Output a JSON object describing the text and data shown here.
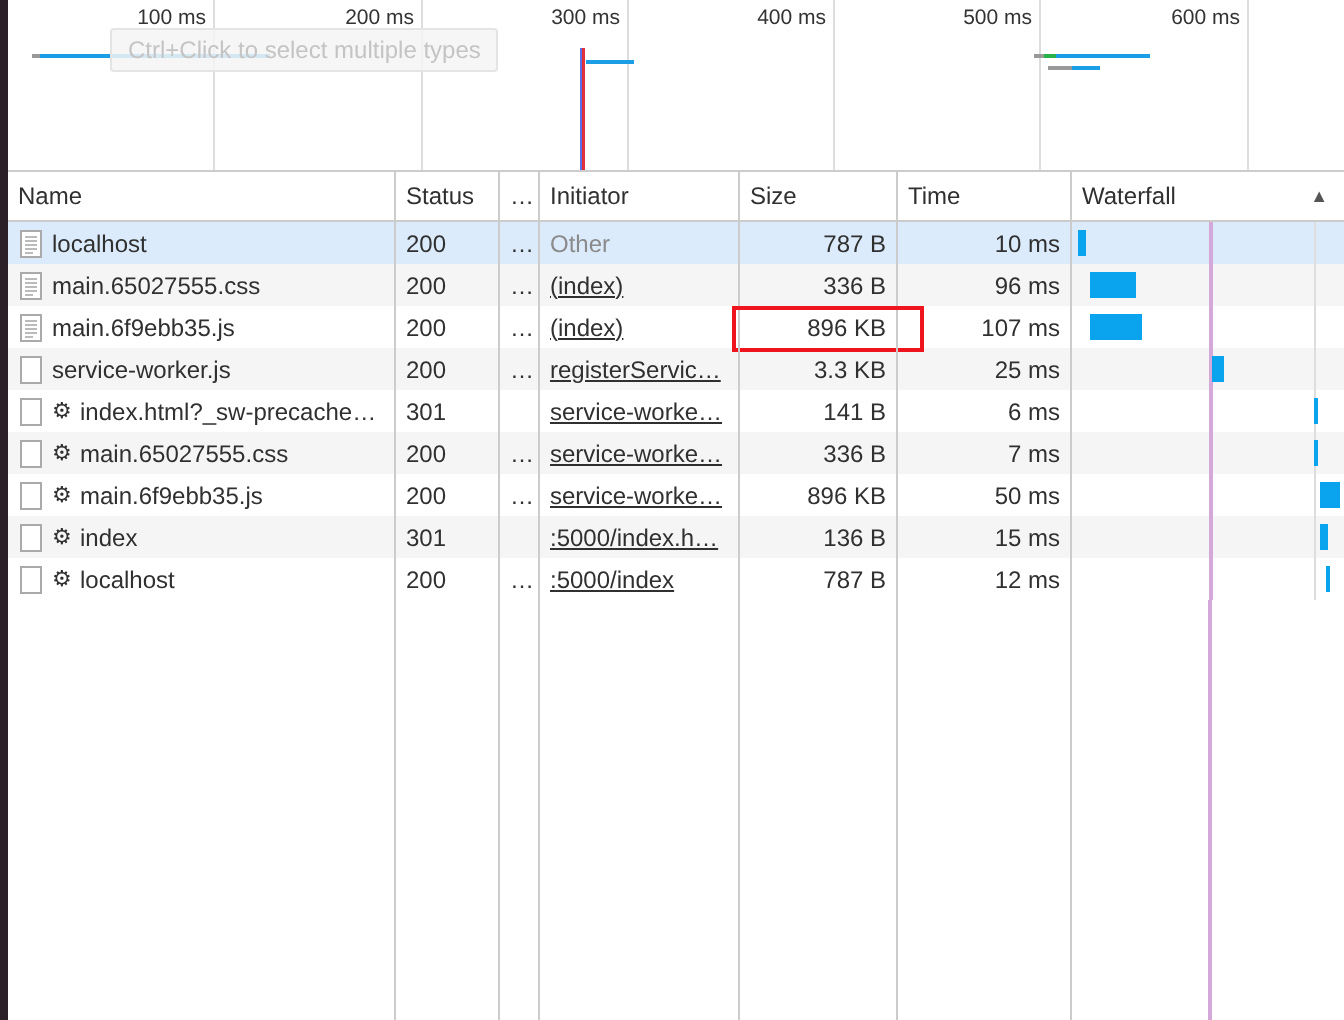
{
  "overview": {
    "ticks": [
      "100 ms",
      "200 ms",
      "300 ms",
      "400 ms",
      "500 ms",
      "600 ms"
    ],
    "tooltip": "Ctrl+Click to select multiple types"
  },
  "table": {
    "columns": [
      {
        "label": "Name"
      },
      {
        "label": "Status"
      },
      {
        "label": "…"
      },
      {
        "label": "Initiator"
      },
      {
        "label": "Size"
      },
      {
        "label": "Time"
      },
      {
        "label": "Waterfall",
        "sort": "▲"
      }
    ],
    "rows": [
      {
        "kind": "document",
        "gear": "",
        "name": "localhost",
        "status": "200",
        "more": "…",
        "initiator": "Other",
        "initiator_link": false,
        "size": "787 B",
        "time": "10 ms",
        "selected": true,
        "highlighted": false
      },
      {
        "kind": "document",
        "gear": "",
        "name": "main.65027555.css",
        "status": "200",
        "more": "…",
        "initiator": "(index)",
        "initiator_link": true,
        "size": "336 B",
        "time": "96 ms",
        "selected": false,
        "highlighted": false
      },
      {
        "kind": "document",
        "gear": "",
        "name": "main.6f9ebb35.js",
        "status": "200",
        "more": "…",
        "initiator": "(index)",
        "initiator_link": true,
        "size": "896 KB",
        "time": "107 ms",
        "selected": false,
        "highlighted": true
      },
      {
        "kind": "blank",
        "gear": "",
        "name": "service-worker.js",
        "status": "200",
        "more": "…",
        "initiator": "registerServic…",
        "initiator_link": true,
        "size": "3.3 KB",
        "time": "25 ms",
        "selected": false,
        "highlighted": false
      },
      {
        "kind": "blank",
        "gear": "⚙",
        "name": "index.html?_sw-precache…",
        "status": "301",
        "more": "",
        "initiator": "service-worke…",
        "initiator_link": true,
        "size": "141 B",
        "time": "6 ms",
        "selected": false,
        "highlighted": false
      },
      {
        "kind": "blank",
        "gear": "⚙",
        "name": "main.65027555.css",
        "status": "200",
        "more": "…",
        "initiator": "service-worke…",
        "initiator_link": true,
        "size": "336 B",
        "time": "7 ms",
        "selected": false,
        "highlighted": false
      },
      {
        "kind": "blank",
        "gear": "⚙",
        "name": "main.6f9ebb35.js",
        "status": "200",
        "more": "…",
        "initiator": "service-worke…",
        "initiator_link": true,
        "size": "896 KB",
        "time": "50 ms",
        "selected": false,
        "highlighted": false
      },
      {
        "kind": "blank",
        "gear": "⚙",
        "name": "index",
        "status": "301",
        "more": "",
        "initiator": ":5000/index.h…",
        "initiator_link": true,
        "size": "136 B",
        "time": "15 ms",
        "selected": false,
        "highlighted": false
      },
      {
        "kind": "blank",
        "gear": "⚙",
        "name": "localhost",
        "status": "200",
        "more": "…",
        "initiator": ":5000/index",
        "initiator_link": true,
        "size": "787 B",
        "time": "12 ms",
        "selected": false,
        "highlighted": false
      }
    ]
  }
}
